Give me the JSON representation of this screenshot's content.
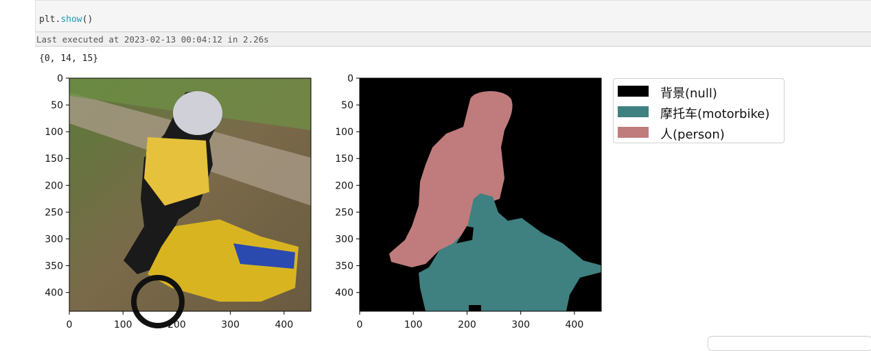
{
  "cell": {
    "code_prefix": "plt.",
    "code_fn": "show",
    "code_suffix": "()",
    "exec_status": "Last executed at 2023-02-13 00:04:12 in 2.26s",
    "output": "{0, 14, 15}"
  },
  "plots": {
    "y_ticks": [
      "0",
      "50",
      "100",
      "150",
      "200",
      "250",
      "300",
      "350",
      "400"
    ],
    "x_ticks": [
      "0",
      "100",
      "200",
      "300",
      "400"
    ]
  },
  "legend": {
    "items": [
      {
        "label": "背景(null)",
        "color": "#000000"
      },
      {
        "label": "摩托车(motorbike)",
        "color": "#3f8080"
      },
      {
        "label": "人(person)",
        "color": "#c07c7c"
      }
    ]
  }
}
